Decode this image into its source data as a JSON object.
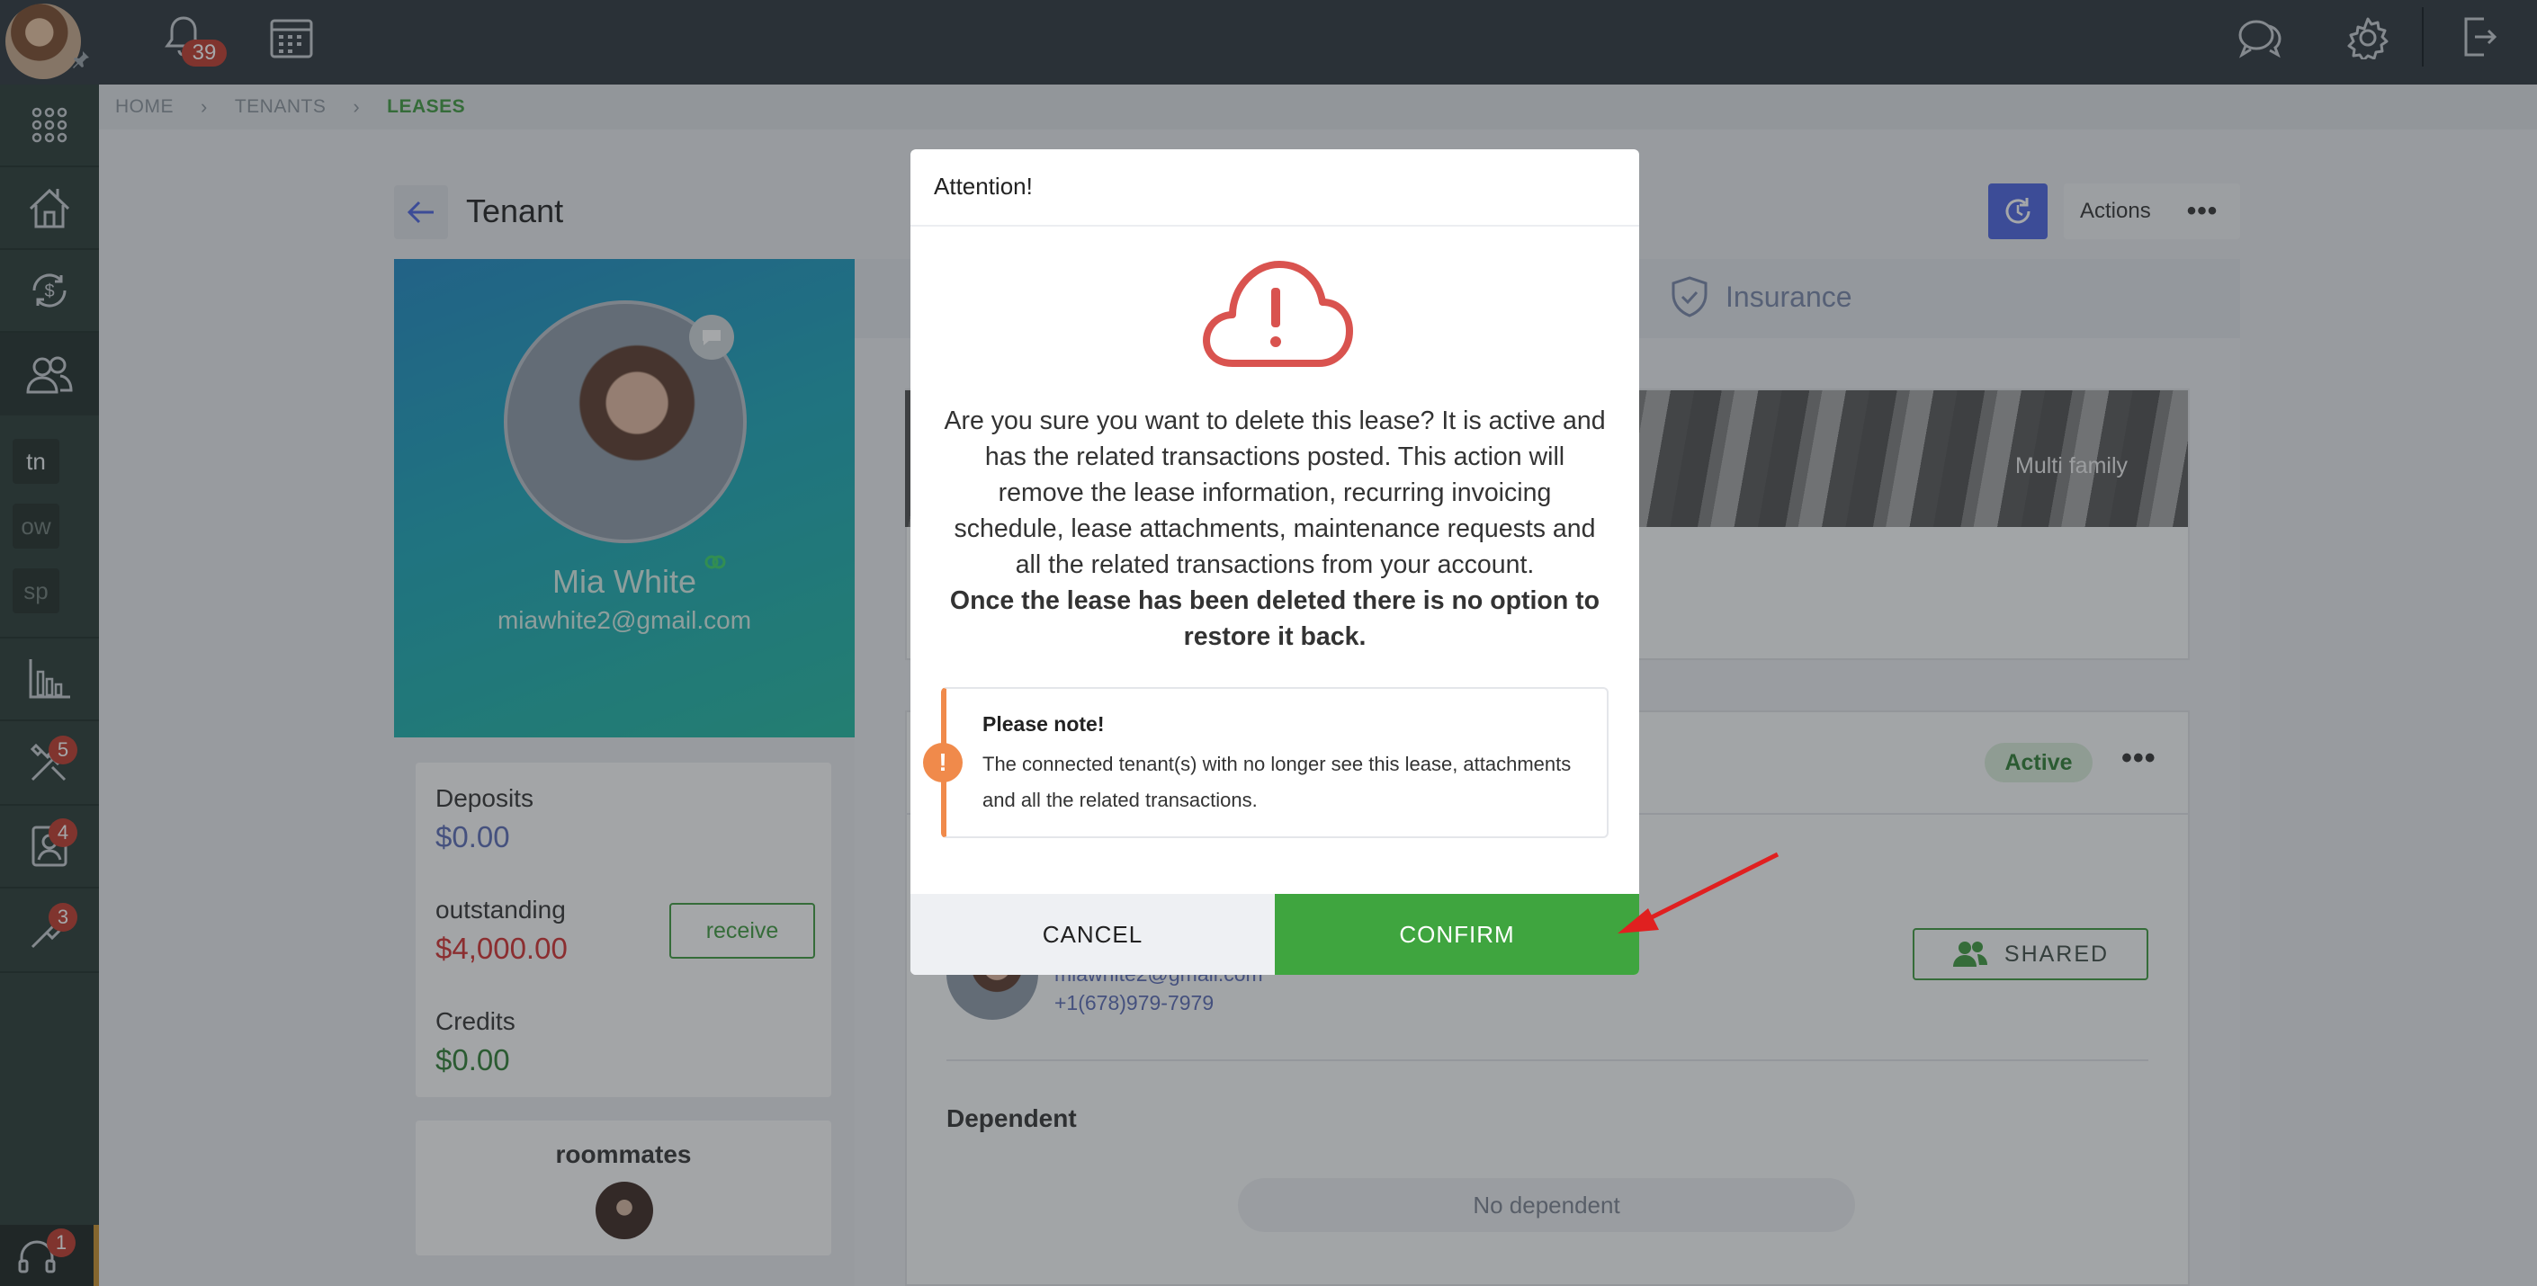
{
  "topbar": {
    "notifications_count": "39",
    "icons": [
      "bell-icon",
      "calendar-icon",
      "chat-icon",
      "gear-icon",
      "logout-icon"
    ]
  },
  "sidebar": {
    "items": [
      {
        "icon": "apps-grid-icon"
      },
      {
        "icon": "properties-icon"
      },
      {
        "icon": "finance-icon"
      },
      {
        "icon": "tenants-icon"
      },
      {
        "label": "tn"
      },
      {
        "label": "ow"
      },
      {
        "label": "sp"
      },
      {
        "icon": "reports-icon"
      },
      {
        "icon": "maintenance-icon",
        "badge": "5"
      },
      {
        "icon": "contacts-icon",
        "badge": "4"
      },
      {
        "icon": "tools-icon",
        "badge": "3"
      },
      {
        "icon": "support-icon",
        "badge": "1"
      }
    ]
  },
  "breadcrumb": {
    "home": "HOME",
    "tenants": "TENANTS",
    "leases": "LEASES"
  },
  "page": {
    "title": "Tenant",
    "actions_label": "Actions"
  },
  "profile": {
    "name": "Mia White",
    "email": "miawhite2@gmail.com"
  },
  "finances": {
    "deposits_label": "Deposits",
    "deposits_value": "$0.00",
    "outstanding_label": "outstanding",
    "outstanding_value": "$4,000.00",
    "receive_label": "receive",
    "credits_label": "Credits",
    "credits_value": "$0.00"
  },
  "roommates": {
    "title": "roommates"
  },
  "tabs": {
    "insurance": "Insurance"
  },
  "property": {
    "type": "Multi family"
  },
  "lease": {
    "status": "Active",
    "shared_label": "SHARED",
    "tenant_email": "miawhite2@gmail.com",
    "tenant_phone": "+1(678)979-7979",
    "dependent_title": "Dependent",
    "no_dependent": "No dependent"
  },
  "modal": {
    "title": "Attention!",
    "message": "Are you sure you want to delete this lease? It is active and has the related transactions posted. This action will remove the lease information, recurring invoicing schedule, lease attachments, maintenance requests and all the related transactions from your account.",
    "message_bold": "Once the lease has been deleted there is no option to restore it back.",
    "note_title": "Please note!",
    "note_text": "The connected tenant(s) with no longer see this lease, attachments and all the related transactions.",
    "cancel_label": "CANCEL",
    "confirm_label": "CONFIRM"
  },
  "colors": {
    "confirm": "#3fa53f",
    "alert": "#d9534f",
    "note_accent": "#f08a4b",
    "outstanding": "#d32f2f",
    "deposits": "#5a6bb5",
    "credits": "#2e7d32"
  }
}
